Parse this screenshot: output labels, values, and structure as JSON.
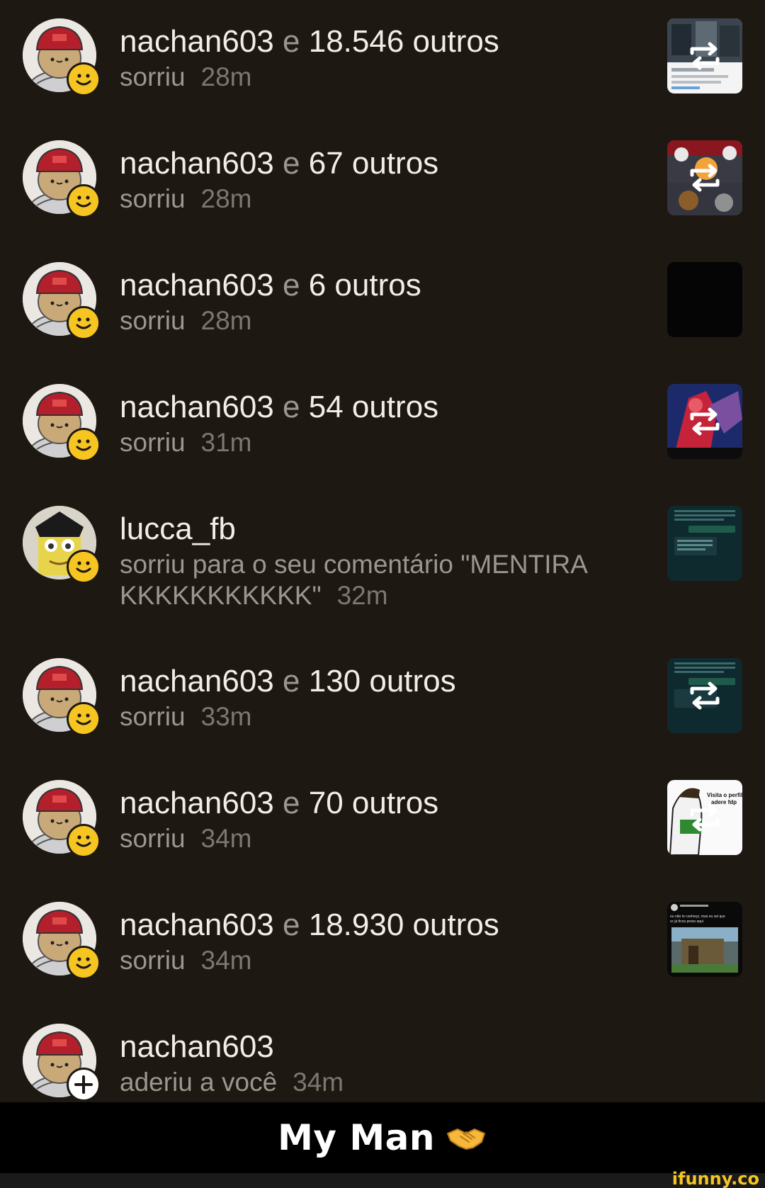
{
  "notifications": [
    {
      "user": "nachan603",
      "conj": "e",
      "others": "18.546 outros",
      "action": "sorriu",
      "time": "28m",
      "avatar_icon": "potato-cap-avatar",
      "badge_icon": "smile-badge-icon",
      "thumb": "tweet-screenshot",
      "repost": true
    },
    {
      "user": "nachan603",
      "conj": "e",
      "others": "67 outros",
      "action": "sorriu",
      "time": "28m",
      "avatar_icon": "potato-cap-avatar",
      "badge_icon": "smile-badge-icon",
      "thumb": "game-screenshot",
      "repost": true
    },
    {
      "user": "nachan603",
      "conj": "e",
      "others": "6 outros",
      "action": "sorriu",
      "time": "28m",
      "avatar_icon": "potato-cap-avatar",
      "badge_icon": "smile-badge-icon",
      "thumb": "black-image",
      "repost": false
    },
    {
      "user": "nachan603",
      "conj": "e",
      "others": "54 outros",
      "action": "sorriu",
      "time": "31m",
      "avatar_icon": "potato-cap-avatar",
      "badge_icon": "smile-badge-icon",
      "thumb": "cartoon-meme",
      "repost": true
    },
    {
      "user": "lucca_fb",
      "conj": "",
      "others": "",
      "action": "sorriu para o seu comentário \"MENTIRA KKKKKKKKKKK\"",
      "time": "32m",
      "avatar_icon": "sponge-avatar",
      "badge_icon": "smile-badge-icon",
      "thumb": "chat-screenshot",
      "repost": false
    },
    {
      "user": "nachan603",
      "conj": "e",
      "others": "130 outros",
      "action": "sorriu",
      "time": "33m",
      "avatar_icon": "potato-cap-avatar",
      "badge_icon": "smile-badge-icon",
      "thumb": "chat-screenshot",
      "repost": true
    },
    {
      "user": "nachan603",
      "conj": "e",
      "others": "70 outros",
      "action": "sorriu",
      "time": "34m",
      "avatar_icon": "potato-cap-avatar",
      "badge_icon": "smile-badge-icon",
      "thumb": "ben10-meme",
      "repost": true
    },
    {
      "user": "nachan603",
      "conj": "e",
      "others": "18.930 outros",
      "action": "sorriu",
      "time": "34m",
      "avatar_icon": "potato-cap-avatar",
      "badge_icon": "smile-badge-icon",
      "thumb": "minecraft-post",
      "repost": false
    },
    {
      "user": "nachan603",
      "conj": "",
      "others": "",
      "action": "aderiu a você",
      "time": "34m",
      "avatar_icon": "potato-cap-avatar",
      "badge_icon": "plus-badge-icon",
      "thumb": "",
      "repost": false
    }
  ],
  "thumb_text": {
    "ben10": "Visita o perfil e n adere fdp",
    "minecraft": "eu não te conheço, mas eu sei que vc já ficou preso aqui"
  },
  "caption": "My Man",
  "watermark": "ifunny.co",
  "colors": {
    "background": "#1e1812",
    "title_text": "#f1eee9",
    "secondary_text": "#9c968f",
    "smile_badge": "#f6c521",
    "caption_bar": "#000000"
  }
}
